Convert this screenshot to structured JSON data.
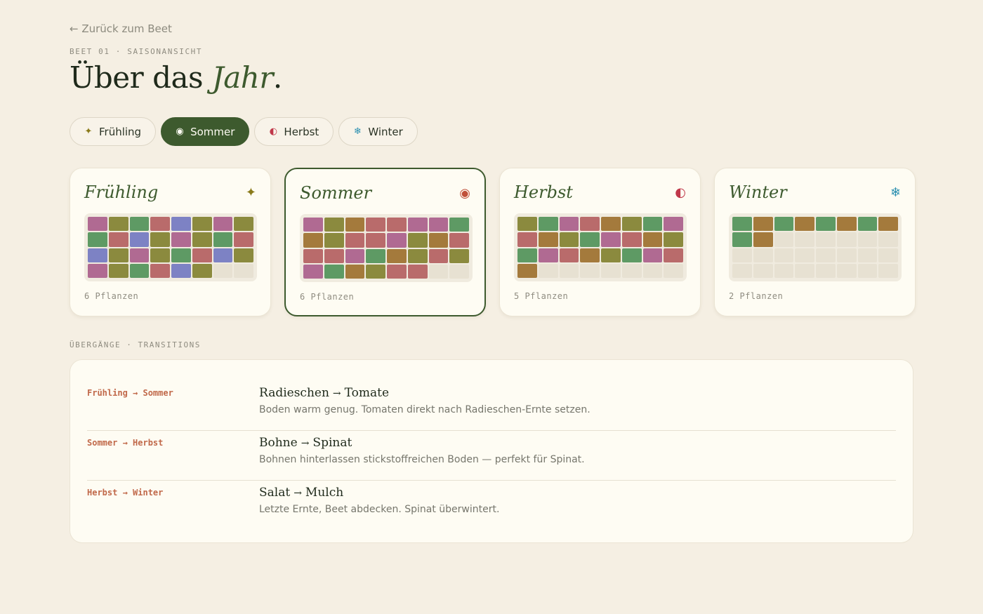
{
  "nav": {
    "back_label": "← Zurück zum Beet"
  },
  "header": {
    "eyebrow": "BEET 01 · SAISONANSICHT",
    "title_prefix": "Über das ",
    "title_accent": "Jahr",
    "title_suffix": "."
  },
  "tabs": [
    {
      "label": "Frühling",
      "icon": "sparkle-icon",
      "glyph": "✦",
      "color": "#8a7a1a",
      "active": false
    },
    {
      "label": "Sommer",
      "icon": "sun-icon",
      "glyph": "◉",
      "color": "#fdfbf2",
      "active": true
    },
    {
      "label": "Herbst",
      "icon": "half-moon-icon",
      "glyph": "◐",
      "color": "#c0384a",
      "active": false
    },
    {
      "label": "Winter",
      "icon": "snowflake-icon",
      "glyph": "❄",
      "color": "#2a8fb0",
      "active": false
    }
  ],
  "colors": {
    "R": "#b96b6b",
    "P": "#b06a92",
    "O": "#a47a3c",
    "G": "#5e9a64",
    "M": "#8b8a3e",
    "B": "#7d82c4",
    "E": "#e7e1d2"
  },
  "seasons": [
    {
      "name": "Frühling",
      "icon": "sparkle-icon",
      "glyph": "✦",
      "icon_color": "#8a7a1a",
      "count": "6 Pflanzen",
      "active": false,
      "grid": [
        "PMGRBMPM",
        "GRBMPMGR",
        "BMPMGRBM",
        "PMGRBMEE"
      ]
    },
    {
      "name": "Sommer",
      "icon": "target-icon",
      "glyph": "◉",
      "icon_color": "#c0503a",
      "count": "6 Pflanzen",
      "active": true,
      "grid": [
        "PMORRPPG",
        "OMRRPMOR",
        "RRPGOMRM",
        "PGOMRREE"
      ]
    },
    {
      "name": "Herbst",
      "icon": "half-moon-icon",
      "glyph": "◐",
      "icon_color": "#c0384a",
      "count": "5 Pflanzen",
      "active": false,
      "grid": [
        "MGPROMGP",
        "ROMGPROM",
        "GPROMGPR",
        "OEEEEEEE"
      ]
    },
    {
      "name": "Winter",
      "icon": "snowflake-icon",
      "glyph": "❄",
      "icon_color": "#2a8fb0",
      "count": "2 Pflanzen",
      "active": false,
      "grid": [
        "GOGOGOGO",
        "GOEEEEEE",
        "EEEEEEEE",
        "EEEEEEEE"
      ]
    }
  ],
  "transitions_label": "ÜBERGÄNGE · TRANSITIONS",
  "transitions": [
    {
      "label": "Frühling → Sommer",
      "from": "Radieschen",
      "to": "Tomate",
      "desc": "Boden warm genug. Tomaten direkt nach Radieschen-Ernte setzen."
    },
    {
      "label": "Sommer → Herbst",
      "from": "Bohne",
      "to": "Spinat",
      "desc": "Bohnen hinterlassen stickstoffreichen Boden — perfekt für Spinat."
    },
    {
      "label": "Herbst → Winter",
      "from": "Salat",
      "to": "Mulch",
      "desc": "Letzte Ernte, Beet abdecken. Spinat überwintert."
    }
  ]
}
